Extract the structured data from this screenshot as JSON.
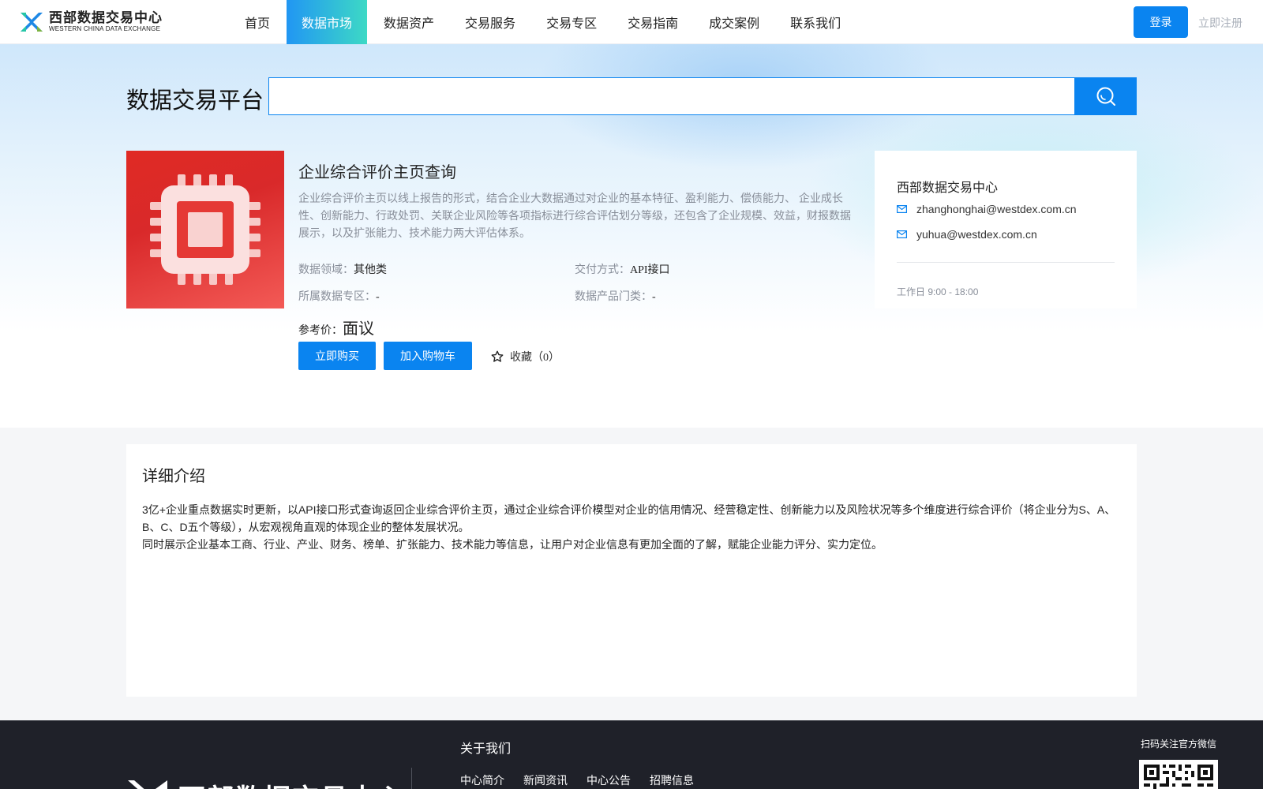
{
  "header": {
    "logo_cn": "西部数据交易中心",
    "logo_en": "WESTERN CHINA DATA EXCHANGE",
    "nav": [
      {
        "label": "首页",
        "active": false
      },
      {
        "label": "数据市场",
        "active": true
      },
      {
        "label": "数据资产",
        "active": false
      },
      {
        "label": "交易服务",
        "active": false
      },
      {
        "label": "交易专区",
        "active": false
      },
      {
        "label": "交易指南",
        "active": false
      },
      {
        "label": "成交案例",
        "active": false
      },
      {
        "label": "联系我们",
        "active": false
      }
    ],
    "login_label": "登录",
    "register_label": "立即注册"
  },
  "search": {
    "title": "数据交易平台",
    "placeholder": "",
    "icon": "search-icon"
  },
  "product": {
    "image_icon": "chip-icon",
    "title": "企业综合评价主页查询",
    "description": "企业综合评价主页以线上报告的形式，结合企业大数据通过对企业的基本特征、盈利能力、偿债能力、 企业成长性、创新能力、行政处罚、关联企业风险等各项指标进行综合评估划分等级，还包含了企业规模、效益，财报数据展示，以及扩张能力、技术能力两大评估体系。",
    "meta": {
      "domain_label": "数据领域：",
      "domain_value": "其他类",
      "delivery_label": "交付方式：",
      "delivery_value": "API接口",
      "zone_label": "所属数据专区：",
      "zone_value": "-",
      "category_label": "数据产品门类：",
      "category_value": "-"
    },
    "price_label": "参考价：",
    "price_value": "面议",
    "buy_label": "立即购买",
    "cart_label": "加入购物车",
    "favorite_label": "收藏（0）"
  },
  "contact": {
    "title": "西部数据交易中心",
    "emails": [
      "zhanghonghai@westdex.com.cn",
      "yuhua@westdex.com.cn"
    ],
    "hours": "工作日 9:00 - 18:00"
  },
  "detail": {
    "title": "详细介绍",
    "paragraphs": [
      "3亿+企业重点数据实时更新，以API接口形式查询返回企业综合评价主页，通过企业综合评价模型对企业的信用情况、经营稳定性、创新能力以及风险状况等多个维度进行综合评价（将企业分为S、A、B、C、D五个等级），从宏观视角直观的体现企业的整体发展状况。",
      "同时展示企业基本工商、行业、产业、财务、榜单、扩张能力、技术能力等信息，让用户对企业信息有更加全面的了解，赋能企业能力评分、实力定位。"
    ]
  },
  "footer": {
    "logo_text": "西部数据交易中心",
    "about_title": "关于我们",
    "links": [
      "中心简介",
      "新闻资讯",
      "中心公告",
      "招聘信息"
    ],
    "qr_label": "扫码关注官方微信"
  },
  "colors": {
    "primary": "#0a84f0",
    "nav_gradient_start": "#2196f3",
    "nav_gradient_end": "#3dd9c5",
    "product_red": "#e02a24",
    "footer_bg": "#1f2129"
  }
}
